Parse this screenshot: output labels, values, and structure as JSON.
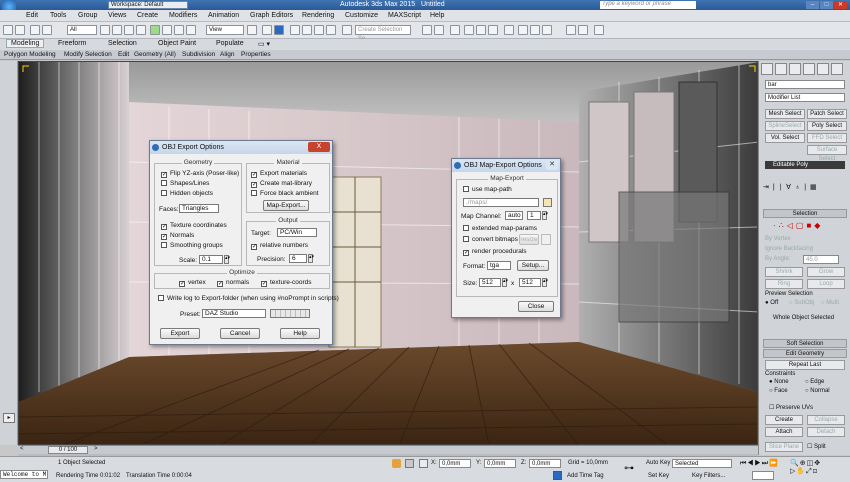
{
  "titlebar": {
    "workspace": "Workspace: Default",
    "app_title": "Autodesk 3ds Max 2015",
    "file": "Untitled",
    "search_placeholder": "Type a keyword or phrase"
  },
  "menu": [
    "Edit",
    "Tools",
    "Group",
    "Views",
    "Create",
    "Modifiers",
    "Animation",
    "Graph Editors",
    "Rendering",
    "Customize",
    "MAXScript",
    "Help"
  ],
  "toolbar": {
    "selection_filter": "All",
    "ref_coord": "View",
    "named_selection_placeholder": "Create Selection Se"
  },
  "ribbon": {
    "tabs": [
      "Modeling",
      "Freeform",
      "Selection",
      "Object Paint",
      "Populate"
    ],
    "sub": [
      "Polygon Modeling",
      "Modify Selection",
      "Edit",
      "Geometry (All)",
      "Subdivision",
      "Align",
      "Properties"
    ]
  },
  "obj_export": {
    "title": "OBJ Export Options",
    "geometry_title": "Geometry",
    "flip_yz": "Flip YZ-axis (Poser-like)",
    "shapes_lines": "Shapes/Lines",
    "hidden_objects": "Hidden objects",
    "faces_label": "Faces:",
    "faces_value": "Triangles",
    "texture_coordinates": "Texture coordinates",
    "normals": "Normals",
    "smoothing_groups": "Smoothing groups",
    "scale_label": "Scale:",
    "scale_value": "0.1",
    "material_title": "Material",
    "export_materials": "Export materials",
    "create_mat_library": "Create mat-library",
    "force_black_ambient": "Force black ambient",
    "map_export_btn": "Map-Export...",
    "output_title": "Output",
    "target_label": "Target:",
    "target_value": "PC/Win",
    "relative_numbers": "relative numbers",
    "precision_label": "Precision:",
    "precision_value": "6",
    "optimize_title": "Optimize",
    "opt_vertex": "vertex",
    "opt_normals": "normals",
    "opt_texture": "texture-coords",
    "write_log": "Write log to Export-folder (when using #noPrompt in scripts)",
    "preset_label": "Preset:",
    "preset_value": "DAZ Studio",
    "export_btn": "Export",
    "cancel_btn": "Cancel",
    "help_btn": "Help",
    "close_glyph": "X"
  },
  "map_export": {
    "title": "OBJ Map-Export Options",
    "group_title": "Map-Export",
    "use_map_path": "use map-path",
    "map_path_placeholder": "./maps/",
    "map_channel_label": "Map Channel:",
    "map_channel_mode": "auto",
    "map_channel_value": "1",
    "extended_map_params": "extended map-params",
    "convert_bitmaps": "convert bitmaps",
    "resize_btn": "resize",
    "render_procedurals": "render procedurals",
    "format_label": "Format:",
    "format_value": "tga",
    "setup_btn": "Setup...",
    "size_label": "Size:",
    "size_w": "512",
    "size_x": "x",
    "size_h": "512",
    "close_btn": "Close",
    "close_glyph": "✕"
  },
  "command_panel": {
    "object_name": "bar",
    "modifier_list": "Modifier List",
    "mesh_select": "Mesh Select",
    "patch_select": "Patch Select",
    "spline_select": "SplineSelect",
    "poly_select": "Poly Select",
    "vol_select": "Vol. Select",
    "ffd_select": "FFD Select",
    "surface_select": "Surface Select",
    "stack_item": "Editable Poly",
    "selection_rollout": "Selection",
    "by_vertex": "By Vertex",
    "ignore_backfacing": "Ignore Backfacing",
    "by_angle": "By Angle:",
    "by_angle_value": "45.0",
    "shrink": "Shrink",
    "grow": "Grow",
    "ring": "Ring",
    "loop": "Loop",
    "preview_selection": "Preview Selection",
    "off": "Off",
    "subobj": "SubObj",
    "multi": "Multi",
    "whole_object_selected": "Whole Object Selected",
    "soft_selection": "Soft Selection",
    "edit_geometry": "Edit Geometry",
    "repeat_last": "Repeat Last",
    "constraints": "Constraints",
    "c_none": "None",
    "c_edge": "Edge",
    "c_face": "Face",
    "c_normal": "Normal",
    "preserve_uvs": "Preserve UVs",
    "create": "Create",
    "collapse": "Collapse",
    "attach": "Attach",
    "detach": "Detach",
    "slice_plane": "Slice Plane",
    "split": "Split"
  },
  "timeline": {
    "frame": "0 / 100",
    "prev": "<",
    "next": ">"
  },
  "status": {
    "script_listener": "Welcome to M",
    "objects_selected": "1 Object Selected",
    "render_time": "Rendering Time 0:01:02",
    "translation_time": "Translation Time 0:00:04",
    "x_label": "X:",
    "x_value": "0,0mm",
    "y_label": "Y:",
    "y_value": "0,0mm",
    "z_label": "Z:",
    "z_value": "0,0mm",
    "grid": "Grid = 10,0mm",
    "add_time_tag": "Add Time Tag",
    "auto_key": "Auto Key",
    "selected": "Selected",
    "set_key": "Set Key",
    "key_filters": "Key Filters..."
  },
  "colors": {
    "accent": "#2a5a96",
    "floor": "#5a3a22",
    "wall": "#d8c8cc"
  }
}
